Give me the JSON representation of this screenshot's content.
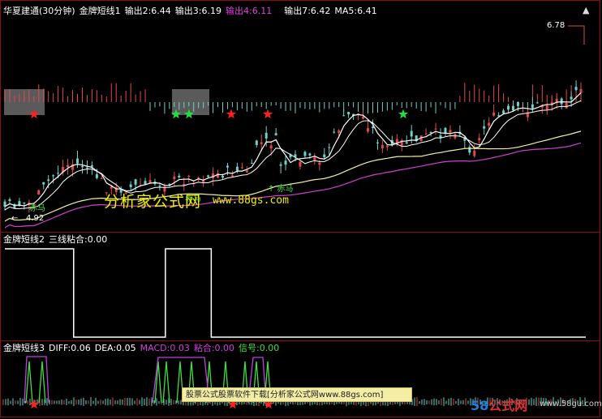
{
  "top_header": {
    "title": "华夏建通(30分钟)",
    "indicator": "金牌短线1",
    "out2": "输出2:6.44",
    "out3": "输出3:6.19",
    "out4": "输出4:6.11",
    "out7": "输出7:6.42",
    "ma5": "MA5:6.41"
  },
  "mid_header": {
    "indicator": "金牌短线2",
    "value": "三线粘合:0.00"
  },
  "bottom_header": {
    "indicator": "金牌短线3",
    "diff": "DIFF:0.06",
    "dea": "DEA:0.05",
    "macd": "MACD:0.03",
    "nianhe": "粘合:0.00",
    "signal": "信号:0.00"
  },
  "chart_labels": {
    "high_price": "6.78",
    "low_price": "4.92",
    "low_arrow": "←",
    "horse_a": "赤马",
    "horse_b": "↑ 赤马",
    "horse_c": "赤马"
  },
  "watermark": {
    "text": "分析家公式网",
    "url": "www.88gs.com"
  },
  "banner": {
    "text": "股票公式股票软件下载[分析家公式网www.88gs.com]"
  },
  "brand": {
    "number": "58",
    "text": "公式网",
    "url": "www.58gu.com"
  },
  "colors": {
    "background": "#000000",
    "frame": "#8a1010",
    "up": "#e04a4a",
    "down": "#6fd0c8",
    "white": "#ffffff",
    "yellow_line": "#f0f0a0",
    "magenta_line": "#d040d0",
    "star_red": "#ff2020",
    "star_green": "#20e040",
    "macd_purple": "#c040e0",
    "signal_green": "#40e040"
  },
  "chart_data": [
    {
      "type": "line",
      "title": "金牌短线1",
      "series": [
        {
          "name": "输出2",
          "values": [
            4.95,
            4.93,
            5.05,
            5.15,
            5.2,
            5.12,
            5.1,
            5.05,
            5.02,
            5.0,
            5.08,
            5.1,
            5.3,
            5.55,
            5.3,
            5.2,
            5.25,
            5.4,
            5.6,
            5.8,
            5.85,
            5.9,
            5.95,
            6.1,
            6.2,
            6.35,
            6.3,
            6.4,
            6.5,
            6.44
          ]
        },
        {
          "name": "输出4",
          "values": [
            4.88,
            4.9,
            4.93,
            4.96,
            4.99,
            5.01,
            5.02,
            5.03,
            5.04,
            5.05,
            5.07,
            5.09,
            5.12,
            5.16,
            5.2,
            5.23,
            5.26,
            5.3,
            5.36,
            5.42,
            5.49,
            5.55,
            5.62,
            5.7,
            5.78,
            5.86,
            5.93,
            6.0,
            6.06,
            6.11
          ]
        },
        {
          "name": "MA5",
          "values": [
            4.96,
            4.95,
            5.02,
            5.1,
            5.16,
            5.12,
            5.08,
            5.04,
            5.0,
            5.01,
            5.06,
            5.1,
            5.25,
            5.45,
            5.35,
            5.25,
            5.28,
            5.38,
            5.55,
            5.75,
            5.82,
            5.88,
            5.93,
            6.05,
            6.18,
            6.3,
            6.32,
            6.38,
            6.45,
            6.41
          ]
        }
      ],
      "high": 6.78,
      "low": 4.92
    },
    {
      "type": "line",
      "title": "金牌短线2",
      "series": [
        {
          "name": "三线粘合",
          "values": [
            1,
            1,
            1,
            1,
            1,
            1,
            1,
            1,
            1,
            0,
            0,
            0,
            0,
            0,
            0,
            0,
            0,
            0,
            0,
            0,
            0,
            1,
            1,
            1,
            1,
            1,
            1,
            0,
            0,
            0,
            0,
            0,
            0,
            0,
            0,
            0,
            0,
            0,
            0,
            0,
            0,
            0,
            0,
            0,
            0,
            0,
            0,
            0,
            0,
            0,
            0,
            0,
            0,
            0,
            0,
            0,
            0,
            0,
            0,
            0,
            0,
            0,
            0,
            0,
            0,
            0,
            0,
            0,
            0,
            0,
            0,
            0,
            0,
            0,
            0,
            0
          ]
        }
      ]
    },
    {
      "type": "line",
      "title": "金牌短线3",
      "series": [
        {
          "name": "DIFF",
          "values": [
            0.06
          ]
        },
        {
          "name": "DEA",
          "values": [
            0.05
          ]
        },
        {
          "name": "MACD",
          "values": [
            0.03
          ]
        },
        {
          "name": "粘合",
          "values": [
            0.0
          ]
        },
        {
          "name": "信号",
          "values": [
            0.0
          ]
        }
      ]
    }
  ]
}
